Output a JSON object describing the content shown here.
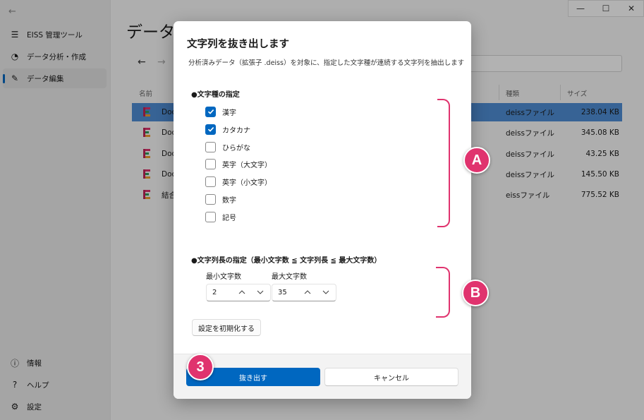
{
  "window": {
    "minimize_glyph": "—",
    "maximize_glyph": "☐",
    "close_glyph": "✕"
  },
  "sidebar": {
    "back_glyph": "←",
    "items": [
      {
        "label": "EISS 管理ツール",
        "icon": "hamburger-icon",
        "glyph": "☰"
      },
      {
        "label": "データ分析・作成",
        "icon": "chart-icon",
        "glyph": "◔"
      },
      {
        "label": "データ編集",
        "icon": "pencil-icon",
        "glyph": "✎"
      }
    ],
    "bottom_items": [
      {
        "label": "情報",
        "icon": "info-icon",
        "glyph": "ⓘ"
      },
      {
        "label": "ヘルプ",
        "icon": "help-icon",
        "glyph": "?"
      },
      {
        "label": "設定",
        "icon": "settings-icon",
        "glyph": "⚙"
      }
    ]
  },
  "main": {
    "title": "データ編",
    "back_glyph": "←",
    "forward_glyph": "→",
    "columns": {
      "name": "名前",
      "type": "種類",
      "size": "サイズ"
    },
    "files": [
      {
        "name": "Doc",
        "type": "deissファイル",
        "size": "238.04 KB",
        "selected": true
      },
      {
        "name": "Doc",
        "type": "deissファイル",
        "size": "345.08 KB",
        "selected": false
      },
      {
        "name": "Doc",
        "type": "deissファイル",
        "size": "43.25 KB",
        "selected": false
      },
      {
        "name": "Doc",
        "type": "deissファイル",
        "size": "145.50 KB",
        "selected": false
      },
      {
        "name": "結合",
        "type": "eissファイル",
        "size": "775.52 KB",
        "selected": false
      }
    ]
  },
  "dialog": {
    "title": "文字列を抜き出します",
    "description": "分析済みデータ（拡張子 .deiss）を対象に、指定した文字種が連続する文字列を抽出します",
    "char_type_heading": "●文字種の指定",
    "char_types": [
      {
        "label": "漢字",
        "checked": true
      },
      {
        "label": "カタカナ",
        "checked": true
      },
      {
        "label": "ひらがな",
        "checked": false
      },
      {
        "label": "英字（大文字）",
        "checked": false
      },
      {
        "label": "英字（小文字）",
        "checked": false
      },
      {
        "label": "数字",
        "checked": false
      },
      {
        "label": "記号",
        "checked": false
      }
    ],
    "length_heading": "●文字列長の指定（最小文字数 ≦ 文字列長 ≦ 最大文字数）",
    "min_label": "最小文字数",
    "max_label": "最大文字数",
    "min_value": "2",
    "max_value": "35",
    "reset_label": "設定を初期化する",
    "extract_label": "抜き出す",
    "cancel_label": "キャンセル"
  },
  "annotations": {
    "a": "A",
    "b": "B",
    "step": "3",
    "color": "#e0336e"
  }
}
